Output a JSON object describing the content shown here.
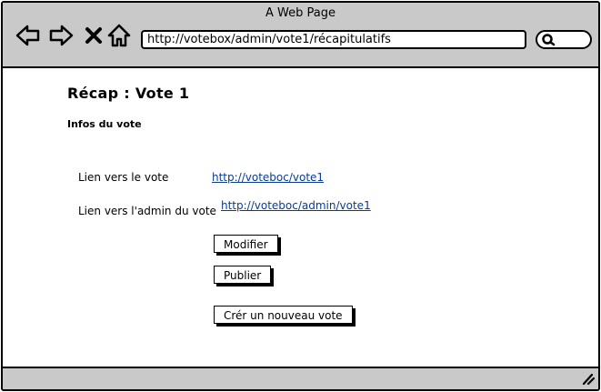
{
  "window": {
    "title": "A Web Page"
  },
  "toolbar": {
    "address": "http://votebox/admin/vote1/récapitulatifs",
    "icons": [
      "back-arrow-icon",
      "forward-arrow-icon",
      "close-x-icon",
      "home-icon",
      "search-icon"
    ]
  },
  "page": {
    "title": "Récap : Vote 1",
    "section": "Infos du vote",
    "rows": [
      {
        "label": "Lien vers le vote",
        "link": "http://voteboc/vote1"
      },
      {
        "label": "Lien vers l'admin du vote",
        "link": "http://voteboc/admin/vote1"
      }
    ],
    "buttons": {
      "modify": "Modifier",
      "publish": "Publier",
      "create": "Crér un nouveau vote"
    }
  },
  "colors": {
    "chrome": "#c9c9c9",
    "link": "#0a3d91",
    "border": "#000000"
  }
}
